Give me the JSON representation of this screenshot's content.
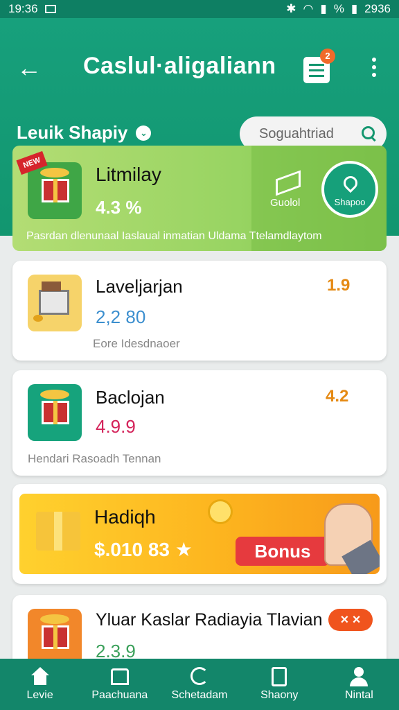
{
  "status_bar": {
    "time": "19:36",
    "battery_label": "%",
    "clock_right": "2936"
  },
  "app_bar": {
    "title": "Caslul·aligalіann",
    "cart_count": "2"
  },
  "filter": {
    "category_label": "Leuik Shapiy",
    "search_placeholder": "Soguahtriad"
  },
  "featured": {
    "tag": "NEW",
    "title": "Litmilay",
    "price": "4.3 %",
    "action_left_label": "Guolol",
    "action_right_label": "Shapoo",
    "description": "Pasrdan dlenunaal Iaslaual inmatian Uldama Ttelamdlaytom",
    "accent_color": "#98d462"
  },
  "items": [
    {
      "title": "Laveljarjan",
      "price": "2,2 80",
      "subtitle": "Eore Idesdnaoer",
      "badge": "1.9",
      "price_color": "#3c8fcf",
      "badge_color": "#e58a14"
    },
    {
      "title": "Baclojan",
      "price": "4.9.9",
      "subtitle": "Hendari Rasoadh Tennan",
      "badge": "4.2",
      "price_color": "#d4235a",
      "badge_color": "#e58a14"
    },
    {
      "title": "Yluar Kaslar Radiayia Tlavian",
      "price": "2.3.9",
      "badge": "× ×",
      "price_color": "#3aa05a",
      "badge_color": "#f0541d"
    }
  ],
  "bonus_card": {
    "title": "Hadiqh",
    "price": "$.010 83 ★",
    "button_label": "Bonus"
  },
  "bottom_nav": [
    {
      "label": "Levie",
      "icon": "home-icon"
    },
    {
      "label": "Paachuana",
      "icon": "shop-icon"
    },
    {
      "label": "Schetadam",
      "icon": "refresh-icon"
    },
    {
      "label": "Shaony",
      "icon": "receipt-icon"
    },
    {
      "label": "Nintal",
      "icon": "profile-icon"
    }
  ]
}
